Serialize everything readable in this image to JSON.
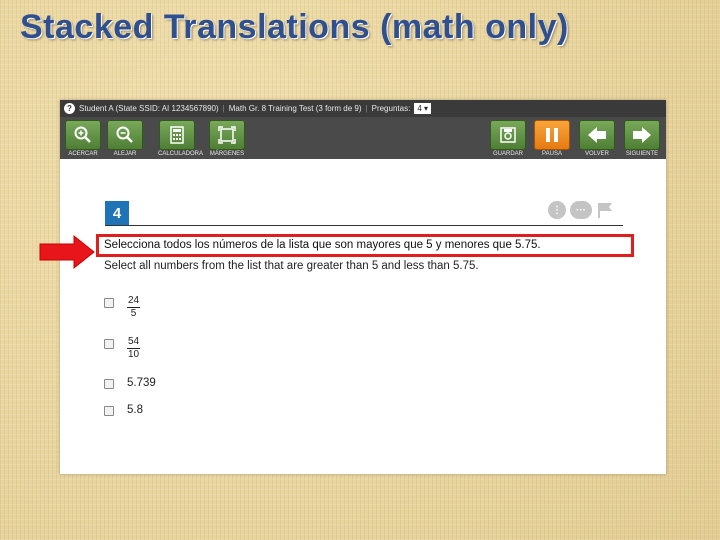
{
  "slide": {
    "title": "Stacked Translations (math only)"
  },
  "info_bar": {
    "student": "Student A (State SSID: AI 1234567890)",
    "test": "Math Gr. 8 Training Test (3 form de 9)",
    "question_label": "Preguntas:",
    "question_selected": "4"
  },
  "toolbar": {
    "left_tools": [
      {
        "label": "ACERCAR",
        "icon": "zoom-in-icon"
      },
      {
        "label": "ALEJAR",
        "icon": "zoom-out-icon"
      },
      {
        "label": "CALCULADORA",
        "icon": "calculator-icon"
      },
      {
        "label": "MÁRGENES",
        "icon": "frame-icon"
      }
    ],
    "right_tools": [
      {
        "label": "GUARDAR",
        "icon": "save-icon"
      },
      {
        "label": "PAUSA",
        "icon": "pause-icon"
      },
      {
        "label": "VOLVER",
        "icon": "back-arrow-icon"
      },
      {
        "label": "SIGUIENTE",
        "icon": "next-arrow-icon"
      }
    ]
  },
  "question": {
    "number": "4",
    "prompt_spanish": "Selecciona todos los números de la lista que son mayores que 5 y menores que 5.75.",
    "prompt_english": "Select all numbers from the list that are greater than 5 and less than 5.75.",
    "options": [
      {
        "type": "fraction",
        "numerator": "24",
        "denominator": "5"
      },
      {
        "type": "fraction",
        "numerator": "54",
        "denominator": "10"
      },
      {
        "type": "text",
        "text": "5.739"
      },
      {
        "type": "text",
        "text": "5.8"
      }
    ]
  },
  "colors": {
    "highlight_border": "#e01e1e",
    "question_badge": "#1f73b7",
    "tool_green": "#5f9142",
    "tool_orange": "#f39a2a",
    "title_blue": "#2f4f8f"
  }
}
